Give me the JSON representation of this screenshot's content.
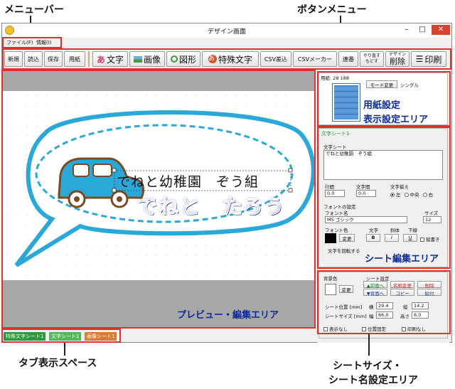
{
  "callouts": {
    "menubar": "メニューバー",
    "button_menu": "ボタンメニュー",
    "paper_settings": "用紙設定",
    "display_settings": "表示設定エリア",
    "sheet_edit": "シート編集エリア",
    "preview_edit": "プレビュー・編集エリア",
    "tab_space": "タブ表示スペース",
    "sheet_size_line1": "シートサイズ・",
    "sheet_size_line2": "シート名設定エリア"
  },
  "window": {
    "title": "デザイン画面",
    "minimize": "–",
    "maximize": "□",
    "close": "✕"
  },
  "menu": {
    "file": "ファイル(F)",
    "info": "情報(I)"
  },
  "toolbar": {
    "new": "新規",
    "open": "読込",
    "save": "保存",
    "paper": "用紙",
    "text": "文字",
    "image": "画像",
    "shape": "図形",
    "special_text": "特殊文字",
    "csv_insert": "CSV差込",
    "csv_maker": "CSVメーカー",
    "serial": "連番",
    "redo": "やり直す",
    "undo": "もどす",
    "design": "デザイン",
    "delete": "削除",
    "print": "印刷"
  },
  "canvas": {
    "line1": "でねと幼稚園　ぞう組",
    "line2": "でねと　たろう"
  },
  "display_panel": {
    "paper_label": "用紙: 28 188",
    "mode_change": "モード変更",
    "single": "シングル"
  },
  "sheet_panel": {
    "title": "文字シート1",
    "text_sheet": "文字シート",
    "text_value": "でねと幼稚園　ぞう組",
    "line_spacing": "行間",
    "char_spacing": "文字間",
    "align": "文字揃え",
    "line_val": "0.0",
    "char_val": "0.0",
    "align_left": "左",
    "align_center": "中央",
    "align_right": "右",
    "font_settings": "フォントの設定",
    "font_name": "フォント名",
    "size": "サイズ",
    "font_value": "MS ゴシック",
    "size_value": "12",
    "font_color": "フォント色",
    "style": "文字",
    "italic": "斜体",
    "underline": "下線",
    "change": "変更",
    "bold_btn": "B",
    "italic_btn": "I",
    "under_btn": "U",
    "vertical": "縦書き",
    "rotate": "文字を回転する"
  },
  "bottom_panel": {
    "bg_color": "背景色",
    "change": "変更",
    "sheet_settings": "シート設定",
    "front": "▲前面へ",
    "back": "▼背面へ",
    "rename": "名称変更",
    "copy": "コピー",
    "delete": "削除",
    "paste": "貼付",
    "pos_label": "シート位置 [mm]",
    "width_h": "横",
    "x_val": "29.4",
    "height_v": "縦",
    "y_val": "14.2",
    "size_label": "シートサイズ [mm]",
    "w_label": "幅",
    "w_val": "66.0",
    "h_label": "高さ",
    "h_val": "6.0",
    "hide": "表示なし",
    "lock_pos": "位置固定",
    "no_print": "印刷なし"
  },
  "tabs": [
    {
      "label": "特殊文字シート1",
      "color": "#2a9a3a"
    },
    {
      "label": "文字シート1",
      "color": "#52b85a"
    },
    {
      "label": "画像シート1",
      "color": "#e07a2a"
    }
  ]
}
